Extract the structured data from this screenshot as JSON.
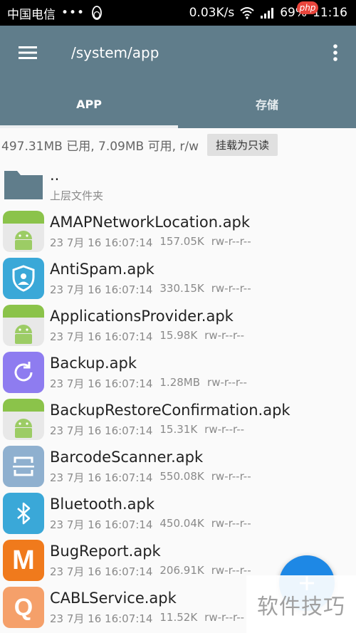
{
  "statusbar": {
    "carrier": "中国电信",
    "dots": "•••",
    "net_speed": "0.03K/s",
    "battery": "69%",
    "time": "11:16",
    "badge": "php"
  },
  "toolbar": {
    "path": "/system/app",
    "menu_icon": "hamburger-icon",
    "more_icon": "more-vert-icon"
  },
  "tabs": [
    {
      "label": "APP"
    },
    {
      "label": "存储"
    }
  ],
  "storage": {
    "summary": "497.31MB 已用, 7.09MB 可用, r/w",
    "button": "挂载为只读"
  },
  "folder": {
    "name": "..",
    "sub": "上层文件夹"
  },
  "files": [
    {
      "name": "AMAPNetworkLocation.apk",
      "date": "23 7月 16 16:07:14",
      "size": "157.05K",
      "perm": "rw-r--r--",
      "icon": "android-icon"
    },
    {
      "name": "AntiSpam.apk",
      "date": "23 7月 16 16:07:14",
      "size": "330.15K",
      "perm": "rw-r--r--",
      "icon": "shield-user-icon"
    },
    {
      "name": "ApplicationsProvider.apk",
      "date": "23 7月 16 16:07:14",
      "size": "15.98K",
      "perm": "rw-r--r--",
      "icon": "android-icon"
    },
    {
      "name": "Backup.apk",
      "date": "23 7月 16 16:07:14",
      "size": "1.28MB",
      "perm": "rw-r--r--",
      "icon": "backup-icon"
    },
    {
      "name": "BackupRestoreConfirmation.apk",
      "date": "23 7月 16 16:07:14",
      "size": "15.31K",
      "perm": "rw-r--r--",
      "icon": "android-icon"
    },
    {
      "name": "BarcodeScanner.apk",
      "date": "23 7月 16 16:07:14",
      "size": "550.08K",
      "perm": "rw-r--r--",
      "icon": "scanner-icon"
    },
    {
      "name": "Bluetooth.apk",
      "date": "23 7月 16 16:07:14",
      "size": "450.04K",
      "perm": "rw-r--r--",
      "icon": "bluetooth-icon"
    },
    {
      "name": "BugReport.apk",
      "date": "23 7月 16 16:07:14",
      "size": "206.91K",
      "perm": "rw-r--r--",
      "icon": "m-letter-icon"
    },
    {
      "name": "CABLService.apk",
      "date": "23 7月 16 16:07:14",
      "size": "11.52K",
      "perm": "rw-r--r--",
      "icon": "q-letter-icon"
    }
  ],
  "icon_letters": {
    "m": "M",
    "q": "Q"
  },
  "watermark": "软件技巧",
  "colors": {
    "toolbar": "#607d8b",
    "fab": "#1e88e5"
  }
}
